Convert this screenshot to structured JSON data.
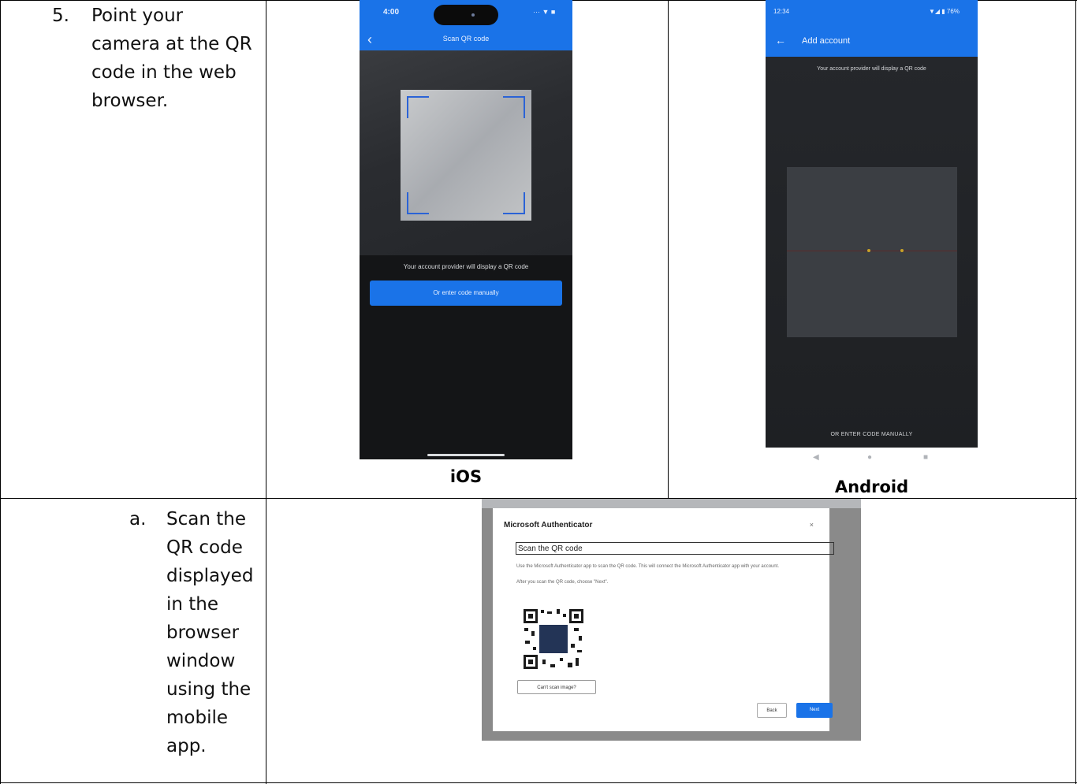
{
  "step5": {
    "number": "5.",
    "lines": [
      "Point your",
      "camera at the QR",
      "code in the web",
      "browser."
    ]
  },
  "ios": {
    "caption": "iOS",
    "status_time": "4:00",
    "status_icons": "··· ▼ ■",
    "screen_title": "Scan QR code",
    "prompt": "Your account provider will display a QR code",
    "manual_button": "Or enter code manually"
  },
  "android": {
    "caption": "Android",
    "status_time": "12:34",
    "status_icons": "▼◢ ▮ 76%",
    "screen_title": "Add account",
    "prompt": "Your account provider will display a QR code",
    "manual_link": "OR ENTER CODE MANUALLY",
    "nav_back": "◀",
    "nav_home": "●",
    "nav_recents": "■"
  },
  "step_a": {
    "letter": "a.",
    "lines": [
      "Scan the",
      "QR code",
      "displayed",
      "in the",
      "browser",
      "window",
      "using the",
      "mobile",
      "app."
    ]
  },
  "dialog": {
    "title": "Microsoft Authenticator",
    "close": "×",
    "heading_field": "Scan the QR code",
    "instructions": "Use the Microsoft Authenticator app to scan the QR code. This will connect the Microsoft Authenticator app with your account.",
    "after_scan": "After you scan the QR code, choose \"Next\".",
    "cant_scan_button": "Can't scan image?",
    "back_button": "Back",
    "next_button": "Next"
  },
  "colors": {
    "accent_blue": "#1a73e8",
    "table_border": "#000000"
  }
}
